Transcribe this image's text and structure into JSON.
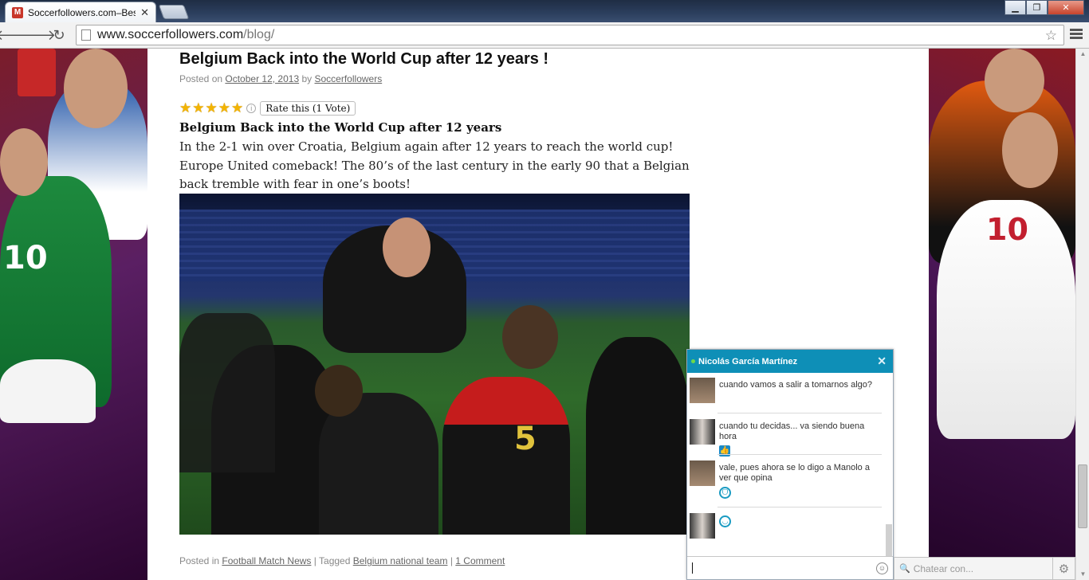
{
  "browser": {
    "tab_title": "Soccerfollowers.com–Best",
    "tab_favicon": "magento-icon",
    "url_host": "www.soccerfollowers.com",
    "url_path": "/blog/"
  },
  "post": {
    "title": "Belgium Back into the World Cup after 12 years !",
    "posted_on_label": "Posted on",
    "date": "October 12, 2013",
    "by_label": "by",
    "author": "Soccerfollowers",
    "rating": {
      "stars": 5,
      "max": 5,
      "label": "Rate this (1 Vote)"
    },
    "subtitle": "Belgium Back into the World Cup after 12 years",
    "body": "In the 2-1 win over Croatia, Belgium again after 12 years to reach the world cup! Europe United comeback! The 80’s of the last century in the early 90 that a Belgian back tremble with fear in one’s boots!",
    "footer": {
      "posted_in_label": "Posted in",
      "category": "Football Match News",
      "tagged_label": "| Tagged",
      "tag": "Belgium national team",
      "separator": "|",
      "comments": "1 Comment"
    }
  },
  "chat": {
    "contact_name": "Nicolás García Martínez",
    "status_color": "#6fd84a",
    "header_color": "#0e8fb7",
    "messages": [
      {
        "text": "cuando vamos a salir a tomarnos algo?",
        "emoji": ""
      },
      {
        "text": "cuando tu decidas... va siendo buena hora",
        "emoji": "thumbs-up-icon"
      },
      {
        "text": "vale, pues ahora se lo digo a Manolo a ver que opina",
        "emoji": "grin-icon"
      },
      {
        "text": "",
        "emoji": "smile-icon"
      }
    ],
    "search_placeholder": "Chatear con..."
  }
}
